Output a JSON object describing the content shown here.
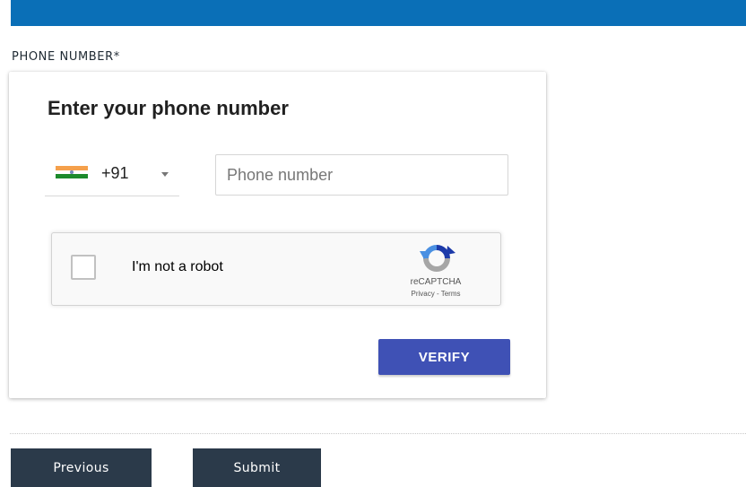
{
  "form": {
    "phone_label": "PHONE NUMBER*"
  },
  "card": {
    "title": "Enter your phone number",
    "country": {
      "flag_icon": "india-flag-icon",
      "dial_code": "+91"
    },
    "phone_input": {
      "value": "",
      "placeholder": "Phone number"
    },
    "recaptcha": {
      "label": "I'm not a robot",
      "brand": "reCAPTCHA",
      "links": "Privacy - Terms",
      "checked": false
    },
    "verify_label": "VERIFY"
  },
  "nav": {
    "previous_label": "Previous",
    "submit_label": "Submit"
  },
  "colors": {
    "topbar": "#0a6fb7",
    "verify_button": "#3f51b5",
    "nav_button": "#2b3a4a"
  }
}
